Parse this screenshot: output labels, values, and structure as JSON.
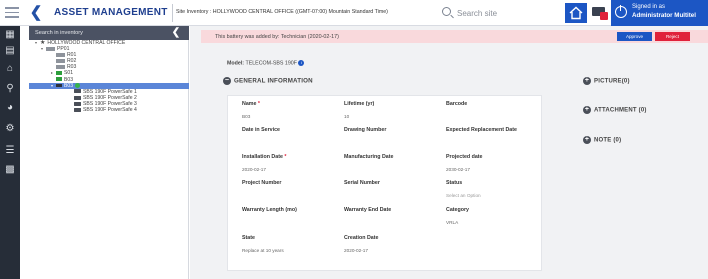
{
  "header": {
    "app_title": "ASSET MANAGEMENT",
    "site_text": "Site Inventory : HOLLYWOOD CENTRAL OFFICE ((GMT-07:00) Mountain Standard Time)",
    "search_placeholder": "Search site",
    "signed_in_as": "Signed in as",
    "user_name": "Administrator Multitel",
    "accent_color": "#1c56c4",
    "alert_badge_color": "#e0223b"
  },
  "rail": {
    "icons": [
      "sim-card-icon",
      "document-icon",
      "home-icon",
      "search-icon",
      "dashboard-icon",
      "user-settings-icon",
      "sliders-icon",
      "calculator-icon"
    ]
  },
  "inventory": {
    "search_label": "Search in inventory",
    "tree": [
      {
        "label": "HOLLYWOOD CENTRAL OFFICE",
        "level": 0,
        "icon": "star",
        "expanded": true
      },
      {
        "label": "PP01",
        "level": 1,
        "icon": "grey",
        "expanded": true
      },
      {
        "label": "R01",
        "level": 2,
        "icon": "grey"
      },
      {
        "label": "R02",
        "level": 2,
        "icon": "grey"
      },
      {
        "label": "R03",
        "level": 2,
        "icon": "grey"
      },
      {
        "label": "S01",
        "level": 2,
        "icon": "green",
        "collapsed": true
      },
      {
        "label": "B03",
        "level": 2,
        "icon": "green"
      },
      {
        "label": "B03",
        "level": 2,
        "icon": "dark",
        "expanded": true,
        "selected": true,
        "status": "ok"
      },
      {
        "label": "SBS 190F PowerSafe 1",
        "level": 3,
        "icon": "bat"
      },
      {
        "label": "SBS 190F PowerSafe 2",
        "level": 3,
        "icon": "bat"
      },
      {
        "label": "SBS 190F PowerSafe 3",
        "level": 3,
        "icon": "bat"
      },
      {
        "label": "SBS 190F PowerSafe 4",
        "level": 3,
        "icon": "bat"
      }
    ]
  },
  "alert": {
    "text": "This battery was added by: Technician (2020-02-17)",
    "approve_label": "Approve",
    "reject_label": "Reject"
  },
  "model": {
    "label": "Model:",
    "value": "TELECOM-SBS 190F"
  },
  "general": {
    "title": "GENERAL INFORMATION",
    "fields": [
      {
        "label": "Name",
        "required": true,
        "value": "B03"
      },
      {
        "label": "Lifetime (yr)",
        "required": false,
        "value": "10"
      },
      {
        "label": "Barcode",
        "required": false,
        "value": ""
      },
      {
        "label": "Date in Service",
        "required": false,
        "value": ""
      },
      {
        "label": "Drawing Number",
        "required": false,
        "value": ""
      },
      {
        "label": "Expected Replacement Date",
        "required": false,
        "value": ""
      },
      {
        "label": "Installation Date",
        "required": true,
        "value": "2020-02-17"
      },
      {
        "label": "Manufacturing Date",
        "required": false,
        "value": ""
      },
      {
        "label": "Projected date",
        "required": false,
        "value": "2030-02-17"
      },
      {
        "label": "Project Number",
        "required": false,
        "value": ""
      },
      {
        "label": "Serial Number",
        "required": false,
        "value": ""
      },
      {
        "label": "Status",
        "required": false,
        "value": "Select an Option",
        "placeholder": true
      },
      {
        "label": "Warranty Length (mo)",
        "required": false,
        "value": ""
      },
      {
        "label": "Warranty End Date",
        "required": false,
        "value": ""
      },
      {
        "label": "Category",
        "required": false,
        "value": "VRLA"
      },
      {
        "label": "State",
        "required": false,
        "value": "Replace at 10 years"
      },
      {
        "label": "Creation Date",
        "required": false,
        "value": "2020-02-17"
      }
    ]
  },
  "side_sections": [
    {
      "label": "PICTURE(0)"
    },
    {
      "label": "ATTACHMENT (0)"
    },
    {
      "label": "NOTE (0)"
    }
  ]
}
